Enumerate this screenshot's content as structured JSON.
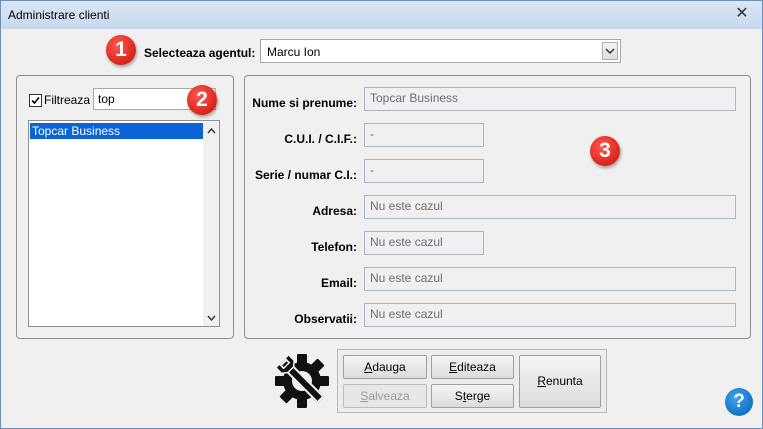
{
  "window": {
    "title": "Administrare clienti",
    "close_glyph": "✕"
  },
  "badges": [
    "1",
    "2",
    "3"
  ],
  "agent": {
    "label": "Selecteaza agentul:",
    "value": "Marcu Ion"
  },
  "filter": {
    "label": "Filtreaza",
    "value": "top",
    "checked": true
  },
  "client_list": {
    "items": [
      "Topcar Business"
    ],
    "selected": "Topcar Business"
  },
  "details": {
    "name_label": "Nume si prenume:",
    "name_value": "Topcar Business",
    "cui_label": "C.U.I. / C.I.F.:",
    "cui_value": "-",
    "ci_label": "Serie / numar C.I.:",
    "ci_value": "-",
    "address_label": "Adresa:",
    "address_value": "Nu este cazul",
    "phone_label": "Telefon:",
    "phone_value": "Nu este cazul",
    "email_label": "Email:",
    "email_value": "Nu este cazul",
    "notes_label": "Observatii:",
    "notes_value": "Nu este cazul"
  },
  "buttons": {
    "add": {
      "pre": "",
      "key": "A",
      "post": "dauga"
    },
    "edit": {
      "pre": "",
      "key": "E",
      "post": "diteaza"
    },
    "cancel": {
      "pre": "",
      "key": "R",
      "post": "enunta"
    },
    "save": {
      "pre": "",
      "key": "S",
      "post": "alveaza"
    },
    "delete": {
      "pre": "S",
      "key": "t",
      "post": "erge"
    }
  },
  "icons": {
    "settings": "gear-wrench-icon",
    "help": "help-icon",
    "help_glyph": "?"
  },
  "colors": {
    "badge": "#e0281f",
    "selection": "#0a64d8",
    "help": "#1e88d8"
  }
}
